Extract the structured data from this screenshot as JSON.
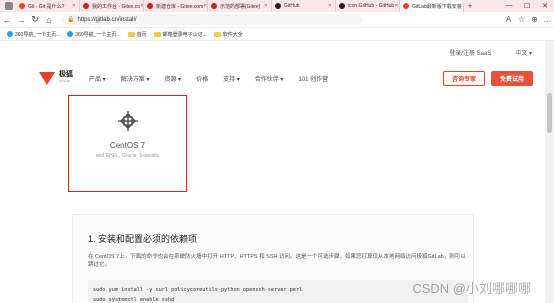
{
  "tabs": [
    {
      "label": "Git - Git 是什么?",
      "color": "#d94a2c",
      "active": false
    },
    {
      "label": "我的工作台 - Gitee.co",
      "color": "#c7271f",
      "active": false
    },
    {
      "label": "新建仓库 - Gitee.com",
      "color": "#c7271f",
      "active": false
    },
    {
      "label": "示范的部署(Gitee)",
      "color": "#c7271f",
      "active": false
    },
    {
      "label": "GitHub",
      "color": "#222222",
      "active": false
    },
    {
      "label": "icon GitHub - GitHub",
      "color": "#222222",
      "active": false
    },
    {
      "label": "GitLab最新版下载安装",
      "color": "#e2432a",
      "active": true
    }
  ],
  "window_controls": {
    "minimize": "—",
    "maximize": "☐",
    "close": "✕"
  },
  "addressbar": {
    "back": "←",
    "forward": "→",
    "reload": "↻",
    "home": "⌂",
    "url": "https://gitlab.cn/install/",
    "right_icons": [
      "A",
      "☆",
      "⊕",
      "…"
    ]
  },
  "bookmarks": [
    {
      "label": "360导航_一个主页...",
      "type": "site",
      "color": "#2f9be8"
    },
    {
      "label": "360导航_一个主页...",
      "type": "site",
      "color": "#2f9be8"
    },
    {
      "label": "首页",
      "type": "folder"
    },
    {
      "label": "邮箱登录电子认证...",
      "type": "folder"
    },
    {
      "label": "软件大全",
      "type": "folder"
    }
  ],
  "header": {
    "login": "登录/注册 SaaS",
    "language": "中文",
    "logo": "极狐",
    "logo_sub": "GITLAB",
    "menu": [
      "产品 ▾",
      "解决方案 ▾",
      "资源 ▾",
      "价格",
      "支持 ▾",
      "合作伙伴 ▾",
      "101 创作营"
    ],
    "consult_button": "咨询专家",
    "trial_button": "免费试用"
  },
  "card": {
    "title": "CentOS 7",
    "subtitle": "and RHEL, Oracle, Scientific"
  },
  "section": {
    "title": "1. 安装和配置必须的依赖项",
    "text": "在 CentOS 7上，下面的命令也会在系统防火墙中打开 HTTP、HTTPS 和 SSH 访问。这是一个可选步骤，如果您打算仅从本地网络访问极狐GitLab，则可以跳过它。",
    "code_lines": [
      "sudo yum install -y curl policycoreutils-python openssh-server perl",
      "sudo systemctl enable sshd"
    ]
  },
  "watermark": "CSDN @小刘哪哪哪"
}
